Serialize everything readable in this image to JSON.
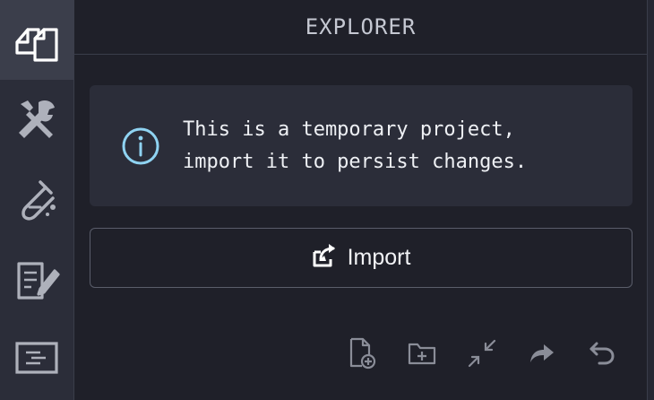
{
  "activity_bar": {
    "items": [
      {
        "icon": "files-icon",
        "active": true
      },
      {
        "icon": "tools-icon",
        "active": false
      },
      {
        "icon": "test-tube-icon",
        "active": false
      },
      {
        "icon": "document-edit-icon",
        "active": false
      },
      {
        "icon": "presentation-icon",
        "active": false
      }
    ]
  },
  "explorer": {
    "title": "EXPLORER",
    "notice": {
      "icon": "info-icon",
      "text": "This is a temporary project,\nimport it to persist changes."
    },
    "import_button": {
      "icon": "import-icon",
      "label": "Import"
    },
    "toolbar": [
      {
        "icon": "new-file-icon"
      },
      {
        "icon": "new-folder-icon"
      },
      {
        "icon": "collapse-icon"
      },
      {
        "icon": "redo-icon"
      },
      {
        "icon": "undo-icon"
      }
    ]
  },
  "colors": {
    "background": "#1f2029",
    "activity_bar": "#2b2d39",
    "active_item": "#3b3e4b",
    "info_accent": "#8fd3f2",
    "text": "#eef0f4",
    "muted_icon": "#8a8d98"
  }
}
